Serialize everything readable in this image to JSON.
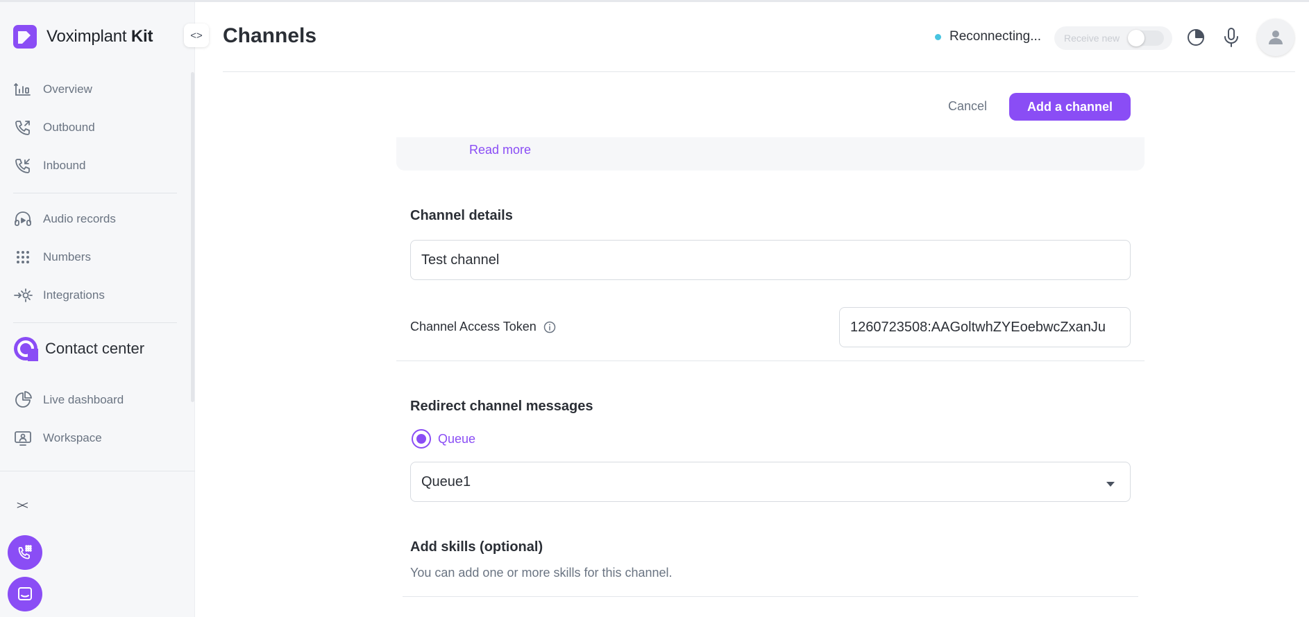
{
  "app": {
    "brand_name": "Voximplant",
    "brand_suffix": "Kit",
    "page_title": "Channels"
  },
  "sidebar": {
    "items": [
      {
        "label": "Overview",
        "icon": "chart-bars-icon"
      },
      {
        "label": "Outbound",
        "icon": "phone-outgoing-icon"
      },
      {
        "label": "Inbound",
        "icon": "phone-incoming-icon"
      },
      {
        "label": "Audio records",
        "icon": "headphones-play-icon"
      },
      {
        "label": "Numbers",
        "icon": "keypad-icon"
      },
      {
        "label": "Integrations",
        "icon": "gear-arrow-icon"
      }
    ],
    "section_title": "Contact center",
    "cc_items": [
      {
        "label": "Live dashboard",
        "icon": "pie-chart-icon"
      },
      {
        "label": "Workspace",
        "icon": "workspace-icon"
      }
    ]
  },
  "header": {
    "status_text": "Reconnecting...",
    "status_color": "#48c4e0",
    "receive_label": "Receive new"
  },
  "actions": {
    "cancel_label": "Cancel",
    "add_label": "Add a channel"
  },
  "content": {
    "read_more": "Read more",
    "channel_details_title": "Channel details",
    "channel_name_value": "Test channel",
    "token_label": "Channel Access Token",
    "token_value": "1260723508:AAGoltwhZYEoebwcZxanJu",
    "redirect_title": "Redirect channel messages",
    "radio_label": "Queue",
    "queue_value": "Queue1",
    "skills_title": "Add skills (optional)",
    "skills_subtitle": "You can add one or more skills for this channel."
  },
  "colors": {
    "accent": "#8a4df5",
    "text": "#2b2f36",
    "muted": "#6a7482"
  }
}
